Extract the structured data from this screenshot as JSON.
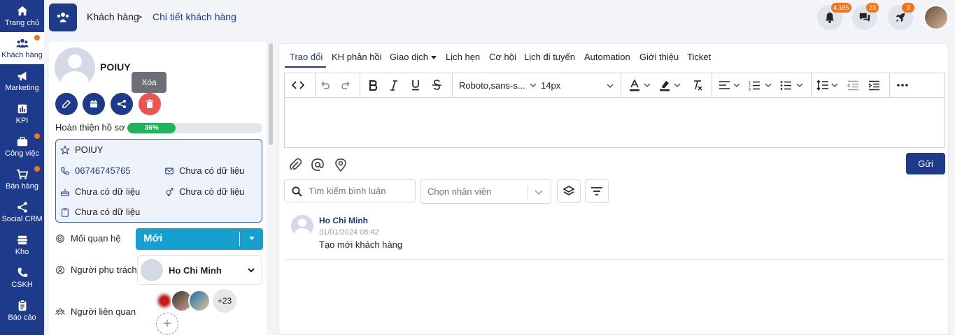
{
  "sidebar": {
    "items": [
      {
        "label": "Trang chủ",
        "icon": "home-icon",
        "active": false,
        "dot": false
      },
      {
        "label": "Khách hàng",
        "icon": "users-icon",
        "active": true,
        "dot": true
      },
      {
        "label": "Marketing",
        "icon": "megaphone-icon",
        "active": false,
        "dot": false
      },
      {
        "label": "KPI",
        "icon": "chart-icon",
        "active": false,
        "dot": false
      },
      {
        "label": "Công việc",
        "icon": "briefcase-icon",
        "active": false,
        "dot": true
      },
      {
        "label": "Bán hàng",
        "icon": "cart-icon",
        "active": false,
        "dot": true
      },
      {
        "label": "Social CRM",
        "icon": "share-icon",
        "active": false,
        "dot": false
      },
      {
        "label": "Kho",
        "icon": "stack-icon",
        "active": false,
        "dot": false
      },
      {
        "label": "CSKH",
        "icon": "phone-icon",
        "active": false,
        "dot": false
      },
      {
        "label": "Báo cáo",
        "icon": "clipboard-icon",
        "active": false,
        "dot": false
      }
    ]
  },
  "header": {
    "breadcrumb_root": "Khách hàng",
    "breadcrumb_sep": ">",
    "breadcrumb_current": "Chi tiết khách hàng",
    "notifications": "4,185",
    "messages": "23",
    "rocket": "3"
  },
  "customer": {
    "name": "POIUY",
    "tooltip": "Xóa",
    "profile_label": "Hoàn thiện hồ sơ",
    "profile_percent": "36%",
    "profile_value": 0.36,
    "info": {
      "name": "POIUY",
      "phone": "06746745765",
      "email": "Chưa có dữ liệu",
      "birthday": "Chưa có dữ liệu",
      "gender": "Chưa có dữ liệu",
      "note": "Chưa có dữ liệu"
    },
    "relationship_label": "Mối quan hệ",
    "relationship_value": "Mới",
    "owner_label": "Người phụ trách",
    "owner_value": "Ho Chi Minh",
    "related_label": "Người liên quan",
    "related_more": "+23",
    "add_symbol": "+"
  },
  "tabs": [
    "Trao đổi",
    "KH phản hồi",
    "Giao dịch",
    "Lịch hẹn",
    "Cơ hội",
    "Lịch đi tuyến",
    "Automation",
    "Giới thiệu",
    "Ticket"
  ],
  "editor": {
    "font": "Roboto,sans-s...",
    "size": "14px"
  },
  "send_label": "Gửi",
  "search": {
    "placeholder": "Tìm kiếm bình luận"
  },
  "staff_select": {
    "placeholder": "Chọn nhân viên"
  },
  "comment": {
    "author": "Ho Chi Minh",
    "date": "31/01/2024 08:42",
    "text": "Tạo mới khách hàng"
  },
  "colors": {
    "primary": "#1e3a8a",
    "accent": "#15a0cf",
    "badge": "#f0761e",
    "delete": "#ef5350",
    "progress": "#22b45a"
  }
}
